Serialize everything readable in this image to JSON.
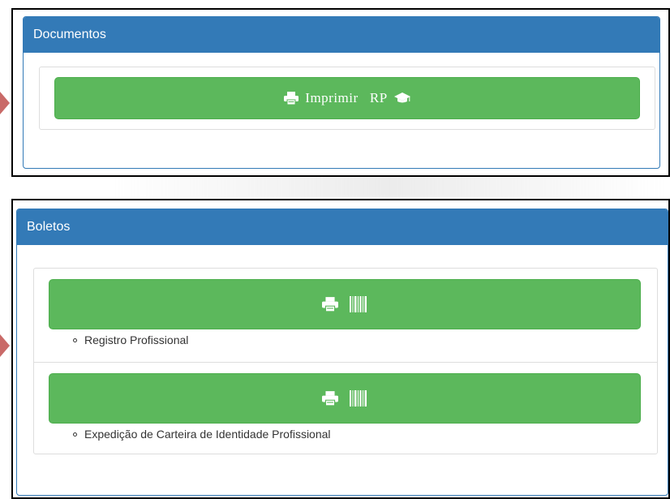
{
  "documentos": {
    "title": "Documentos",
    "print_button_label": "Imprimir   RP",
    "icons": [
      "printer-icon",
      "graduation-cap-icon"
    ]
  },
  "boletos": {
    "title": "Boletos",
    "items": [
      {
        "label": "Registro Profissional",
        "icons": [
          "printer-icon",
          "barcode-icon"
        ]
      },
      {
        "label": "Expedição de Carteira de Identidade Profissional",
        "icons": [
          "printer-icon",
          "barcode-icon"
        ]
      }
    ]
  },
  "colors": {
    "panel_primary": "#337ab7",
    "button_success": "#5cb85c",
    "annotation_arrow": "#c0504d"
  }
}
